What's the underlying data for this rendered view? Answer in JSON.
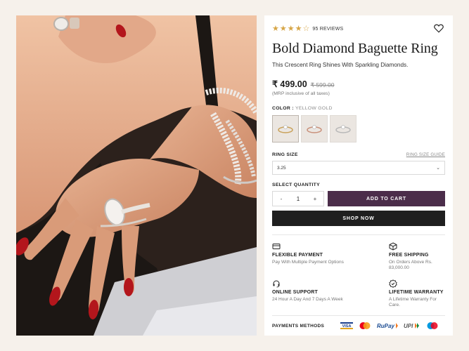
{
  "photo": {
    "alt_icon": "product-photo"
  },
  "rating": {
    "stars": 4,
    "max": 5,
    "reviews": "95 REVIEWS"
  },
  "product": {
    "title": "Bold Diamond Baguette Ring",
    "subtitle": "This Crescent Ring Shines With Sparkling Diamonds.",
    "price": "₹ 499.00",
    "old_price": "₹ 599.00",
    "mrp_note": "(MRP inclusive of all taxes)"
  },
  "color": {
    "label": "COLOR : ",
    "value": "YELLOW GOLD",
    "swatches": [
      "yellow-gold",
      "rose-gold",
      "white-gold"
    ]
  },
  "size": {
    "label": "RING SIZE",
    "guide": "RING SIZE GUIDE",
    "selected": "3.25"
  },
  "quantity": {
    "label": "SELECT QUANTITY",
    "minus": "-",
    "value": "1",
    "plus": "+"
  },
  "actions": {
    "add_to_cart": "ADD TO CART",
    "shop_now": "SHOP NOW"
  },
  "features": [
    {
      "icon": "payment-icon",
      "title": "FLEXIBLE PAYMENT",
      "desc": "Pay With Multiple Payment Options"
    },
    {
      "icon": "box-icon",
      "title": "FREE SHIPPING",
      "desc": "On Orders Above Rs. 83,000.00"
    },
    {
      "icon": "headset-icon",
      "title": "ONLINE SUPPORT",
      "desc": "24 Hour A Day And 7 Days A Week"
    },
    {
      "icon": "badge-check-icon",
      "title": "LIFETIME WARRANTY",
      "desc": "A Lifetime Warranty For Care."
    }
  ],
  "payments": {
    "label": "PAYMENTS METHODS",
    "methods": [
      "VISA",
      "mastercard",
      "RuPay",
      "UPI",
      "maestro"
    ]
  },
  "colors": {
    "accent": "#4b2d4a",
    "dark": "#1f1f1f",
    "star": "#d6a546",
    "bg": "#f6f1eb"
  }
}
